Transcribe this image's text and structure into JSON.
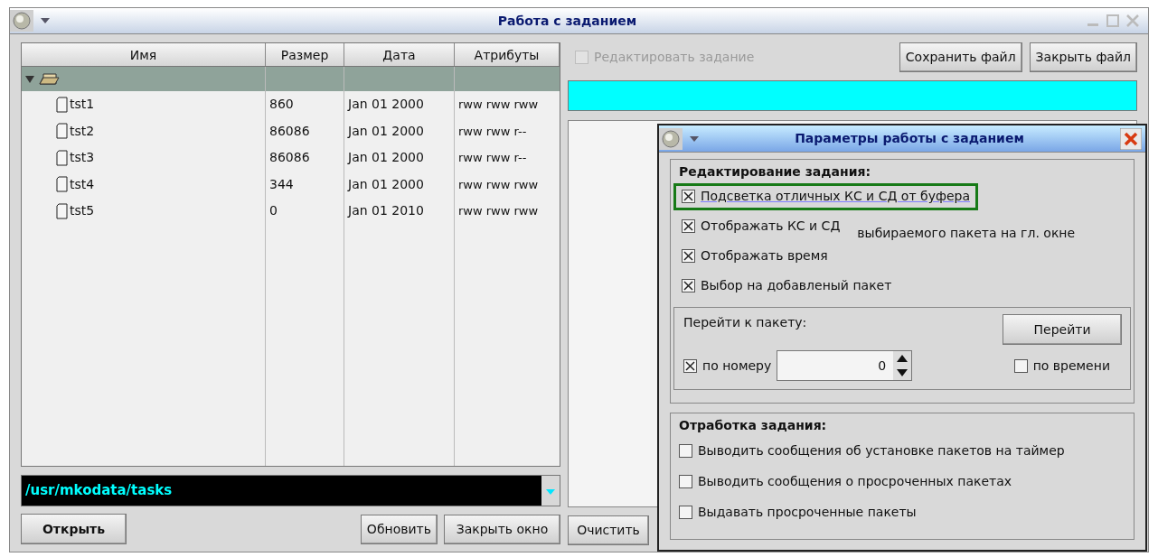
{
  "window": {
    "title": "Работа с заданием"
  },
  "table": {
    "columns": [
      "Имя",
      "Размер",
      "Дата",
      "Атрибуты"
    ],
    "folder": {
      "expanded": true,
      "selected": true
    },
    "rows": [
      {
        "name": "tst1",
        "size": "860",
        "date": "Jan 01 2000",
        "attrs": "rww rww rww"
      },
      {
        "name": "tst2",
        "size": "86086",
        "date": "Jan 01 2000",
        "attrs": "rww rww r--"
      },
      {
        "name": "tst3",
        "size": "86086",
        "date": "Jan 01 2000",
        "attrs": "rww rww r--"
      },
      {
        "name": "tst4",
        "size": "344",
        "date": "Jan 01 2000",
        "attrs": "rww rww rww"
      },
      {
        "name": "tst5",
        "size": "0",
        "date": "Jan 01 2010",
        "attrs": "rww rww rww"
      }
    ]
  },
  "path_field": {
    "value": "/usr/mkodata/tasks"
  },
  "left_buttons": {
    "open": "Открыть",
    "refresh": "Обновить",
    "close_window": "Закрыть окно"
  },
  "clear_button": "Очистить",
  "edit_task": {
    "label": "Редактировать задание",
    "checked": false,
    "disabled": true
  },
  "file_buttons": [
    "Сохранить файл",
    "Закрыть файл"
  ],
  "dialog": {
    "title": "Параметры работы с заданием",
    "edit_section": {
      "title": "Редактирование задания:",
      "options": [
        {
          "label": "Подсветка отличных КС и СД от буфера",
          "checked": true,
          "focused": true
        },
        {
          "label": "Отображать КС и СД",
          "checked": true,
          "focused": false,
          "note": "выбираемого пакета на гл. окне"
        },
        {
          "label": "Отображать время",
          "checked": true,
          "focused": false
        },
        {
          "label": "Выбор на добавленый пакет",
          "checked": true,
          "focused": false
        }
      ]
    },
    "goto": {
      "title": "Перейти к пакету:",
      "button": "Перейти",
      "by_number": {
        "label": "по номеру",
        "checked": true
      },
      "number": "0",
      "by_time": {
        "label": "по времени",
        "checked": false
      }
    },
    "process_section": {
      "title": "Отработка задания:",
      "options": [
        {
          "label": "Выводить сообщения об установке пакетов на таймер",
          "checked": false
        },
        {
          "label": "Выводить сообщения о просроченных пакетах",
          "checked": false
        },
        {
          "label": "Выдавать просроченные пакеты",
          "checked": false
        }
      ]
    }
  }
}
